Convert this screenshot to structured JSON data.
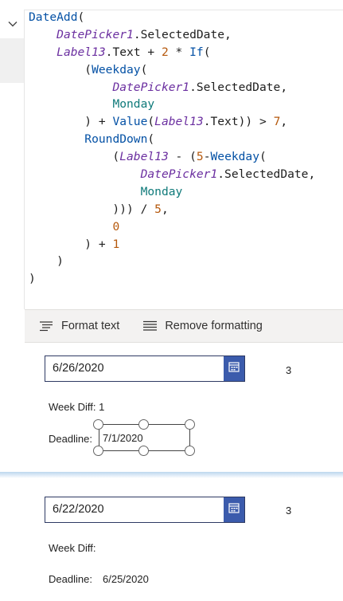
{
  "formula": {
    "lines": [
      [
        {
          "t": "DateAdd",
          "c": "func"
        },
        {
          "t": "(",
          "c": "text"
        }
      ],
      [
        {
          "t": "    ",
          "c": "text"
        },
        {
          "t": "DatePicker1",
          "c": "ctrl"
        },
        {
          "t": ".SelectedDate,",
          "c": "text"
        }
      ],
      [
        {
          "t": "    ",
          "c": "text"
        },
        {
          "t": "Label13",
          "c": "ctrl"
        },
        {
          "t": ".Text + ",
          "c": "text"
        },
        {
          "t": "2",
          "c": "num"
        },
        {
          "t": " * ",
          "c": "text"
        },
        {
          "t": "If",
          "c": "func"
        },
        {
          "t": "(",
          "c": "text"
        }
      ],
      [
        {
          "t": "        (",
          "c": "text"
        },
        {
          "t": "Weekday",
          "c": "func"
        },
        {
          "t": "(",
          "c": "text"
        }
      ],
      [
        {
          "t": "            ",
          "c": "text"
        },
        {
          "t": "DatePicker1",
          "c": "ctrl"
        },
        {
          "t": ".SelectedDate,",
          "c": "text"
        }
      ],
      [
        {
          "t": "            ",
          "c": "text"
        },
        {
          "t": "Monday",
          "c": "enum"
        }
      ],
      [
        {
          "t": "        ) + ",
          "c": "text"
        },
        {
          "t": "Value",
          "c": "func"
        },
        {
          "t": "(",
          "c": "text"
        },
        {
          "t": "Label13",
          "c": "ctrl"
        },
        {
          "t": ".Text)) > ",
          "c": "text"
        },
        {
          "t": "7",
          "c": "num"
        },
        {
          "t": ",",
          "c": "text"
        }
      ],
      [
        {
          "t": "        ",
          "c": "text"
        },
        {
          "t": "RoundDown",
          "c": "func"
        },
        {
          "t": "(",
          "c": "text"
        }
      ],
      [
        {
          "t": "            (",
          "c": "text"
        },
        {
          "t": "Label13",
          "c": "ctrl"
        },
        {
          "t": " - (",
          "c": "text"
        },
        {
          "t": "5",
          "c": "num"
        },
        {
          "t": "-",
          "c": "text"
        },
        {
          "t": "Weekday",
          "c": "func"
        },
        {
          "t": "(",
          "c": "text"
        }
      ],
      [
        {
          "t": "                ",
          "c": "text"
        },
        {
          "t": "DatePicker1",
          "c": "ctrl"
        },
        {
          "t": ".SelectedDate,",
          "c": "text"
        }
      ],
      [
        {
          "t": "                ",
          "c": "text"
        },
        {
          "t": "Monday",
          "c": "enum"
        }
      ],
      [
        {
          "t": "            ))) / ",
          "c": "text"
        },
        {
          "t": "5",
          "c": "num"
        },
        {
          "t": ",",
          "c": "text"
        }
      ],
      [
        {
          "t": "            ",
          "c": "text"
        },
        {
          "t": "0",
          "c": "num"
        }
      ],
      [
        {
          "t": "        ) + ",
          "c": "text"
        },
        {
          "t": "1",
          "c": "num"
        }
      ],
      [
        {
          "t": "    )",
          "c": "text"
        }
      ],
      [
        {
          "t": ")",
          "c": "text"
        }
      ]
    ]
  },
  "toolbar": {
    "format_text": "Format text",
    "remove_formatting": "Remove formatting"
  },
  "screen1": {
    "date_value": "6/26/2020",
    "number": "3",
    "week_diff": "Week Diff: 1",
    "deadline_label": "Deadline:",
    "deadline_value": "7/1/2020"
  },
  "screen2": {
    "date_value": "6/22/2020",
    "number": "3",
    "week_diff": "Week Diff:",
    "deadline_label": "Deadline:",
    "deadline_value": "6/25/2020"
  },
  "colors": {
    "func": "#0451a5",
    "control": "#6b2fa0",
    "number": "#b5580c",
    "enum": "#0f7a7a",
    "picker_button": "#3b5bac"
  },
  "icons": {
    "collapse": "chevron-down-icon",
    "format_text": "format-text-icon",
    "remove_formatting": "remove-formatting-icon",
    "calendar": "calendar-icon"
  }
}
